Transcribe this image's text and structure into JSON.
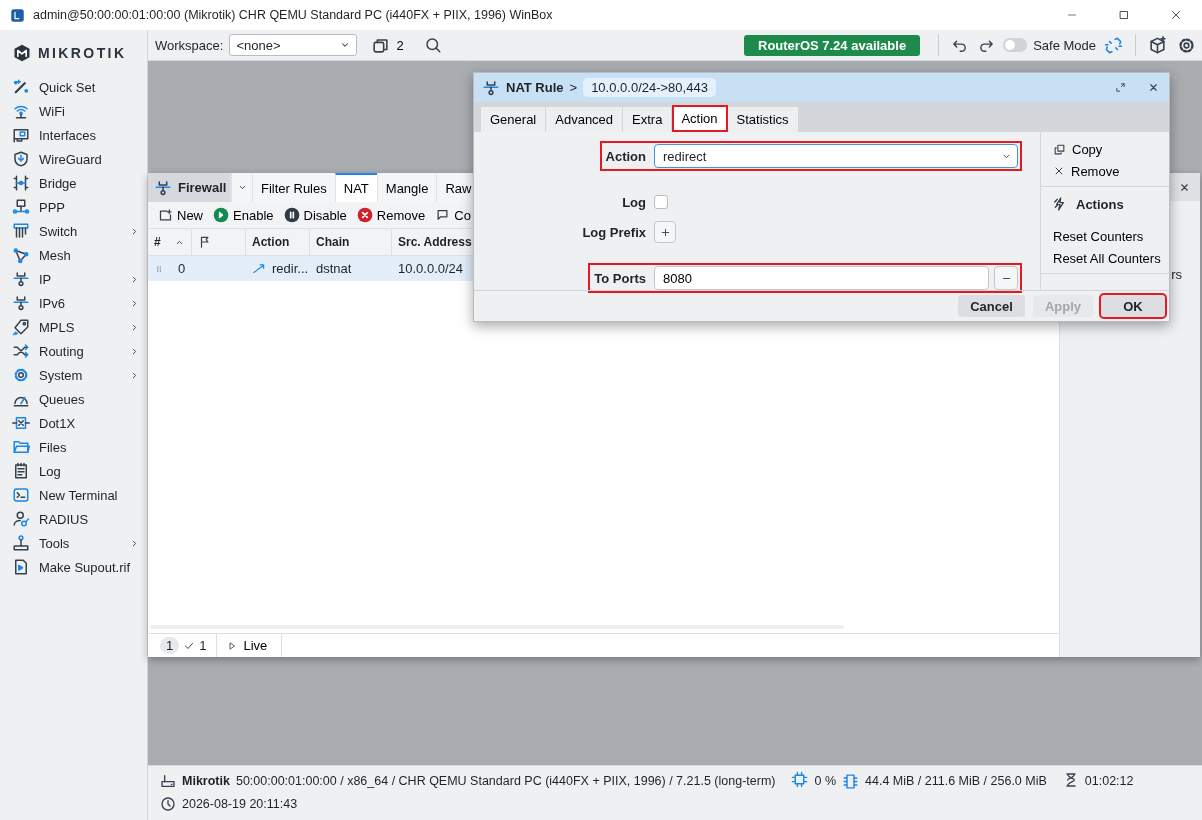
{
  "window": {
    "title": "admin@50:00:00:01:00:00 (Mikrotik) CHR QEMU Standard PC (i440FX + PIIX, 1996) WinBox"
  },
  "brand": {
    "name": "MIKROTIK"
  },
  "sidebar": {
    "items": [
      {
        "label": "Quick Set",
        "has_submenu": false
      },
      {
        "label": "WiFi",
        "has_submenu": false
      },
      {
        "label": "Interfaces",
        "has_submenu": false
      },
      {
        "label": "WireGuard",
        "has_submenu": false
      },
      {
        "label": "Bridge",
        "has_submenu": false
      },
      {
        "label": "PPP",
        "has_submenu": false
      },
      {
        "label": "Switch",
        "has_submenu": true
      },
      {
        "label": "Mesh",
        "has_submenu": false
      },
      {
        "label": "IP",
        "has_submenu": true
      },
      {
        "label": "IPv6",
        "has_submenu": true
      },
      {
        "label": "MPLS",
        "has_submenu": true
      },
      {
        "label": "Routing",
        "has_submenu": true
      },
      {
        "label": "System",
        "has_submenu": true
      },
      {
        "label": "Queues",
        "has_submenu": false
      },
      {
        "label": "Dot1X",
        "has_submenu": false
      },
      {
        "label": "Files",
        "has_submenu": false
      },
      {
        "label": "Log",
        "has_submenu": false
      },
      {
        "label": "New Terminal",
        "has_submenu": false
      },
      {
        "label": "RADIUS",
        "has_submenu": false
      },
      {
        "label": "Tools",
        "has_submenu": true
      },
      {
        "label": "Make Supout.rif",
        "has_submenu": false
      }
    ]
  },
  "toolbar": {
    "workspace_label": "Workspace:",
    "workspace_value": "<none>",
    "window_count": "2",
    "update_badge": "RouterOS 7.24 available",
    "safe_mode": {
      "label": "Safe Mode",
      "on": false
    }
  },
  "firewall_window": {
    "title": "Firewall",
    "tabs": [
      {
        "label": "Filter Rules",
        "selected": false
      },
      {
        "label": "NAT",
        "selected": true
      },
      {
        "label": "Mangle",
        "selected": false
      },
      {
        "label": "Raw",
        "selected": false
      }
    ],
    "actions": [
      {
        "label": "New",
        "kind": "new"
      },
      {
        "label": "Enable",
        "kind": "enable"
      },
      {
        "label": "Disable",
        "kind": "disable"
      },
      {
        "label": "Remove",
        "kind": "remove"
      },
      {
        "label": "Co",
        "kind": "comment"
      }
    ],
    "columns": [
      "#",
      "Action",
      "Chain",
      "Src. Address"
    ],
    "rows": [
      {
        "number": "0",
        "action": "redir...",
        "chain": "dstnat",
        "src_address": "10.0.0.0/24",
        "selected": true
      }
    ],
    "side_panel_text": "rs",
    "footer": {
      "count": "1",
      "checked_count": "1",
      "live_label": "Live"
    }
  },
  "nat_dialog": {
    "title": "NAT Rule",
    "separator": ">",
    "rule": "10.0.0.0/24->80,443",
    "tabs": [
      {
        "label": "General",
        "selected": false,
        "highlighted": false
      },
      {
        "label": "Advanced",
        "selected": false,
        "highlighted": false
      },
      {
        "label": "Extra",
        "selected": false,
        "highlighted": false
      },
      {
        "label": "Action",
        "selected": true,
        "highlighted": true
      },
      {
        "label": "Statistics",
        "selected": false,
        "highlighted": false
      }
    ],
    "action": {
      "label": "Action",
      "value": "redirect",
      "highlighted": true
    },
    "log": {
      "label": "Log",
      "checked": false
    },
    "log_prefix": {
      "label": "Log Prefix"
    },
    "to_ports": {
      "label": "To Ports",
      "value": "8080",
      "highlighted": true
    },
    "side_items": [
      {
        "label": "Copy",
        "kind": "copy"
      },
      {
        "label": "Remove",
        "kind": "remove"
      }
    ],
    "actions_heading": "Actions",
    "actions": [
      "Reset Counters",
      "Reset All Counters"
    ],
    "buttons": [
      {
        "label": "Cancel",
        "disabled": false,
        "highlighted": false
      },
      {
        "label": "Apply",
        "disabled": true,
        "highlighted": false
      },
      {
        "label": "OK",
        "disabled": false,
        "highlighted": true
      }
    ]
  },
  "status_bar": {
    "router_name": "Mikrotik",
    "router_info": "50:00:00:01:00:00 / x86_64 / CHR QEMU Standard PC (i440FX + PIIX, 1996) / 7.21.5 (long-term)",
    "cpu": "0 %",
    "memory": "44.4 MiB / 211.6 MiB / 256.0 MiB",
    "uptime": "01:02:12",
    "datetime": "2026-08-19 20:11:43"
  }
}
